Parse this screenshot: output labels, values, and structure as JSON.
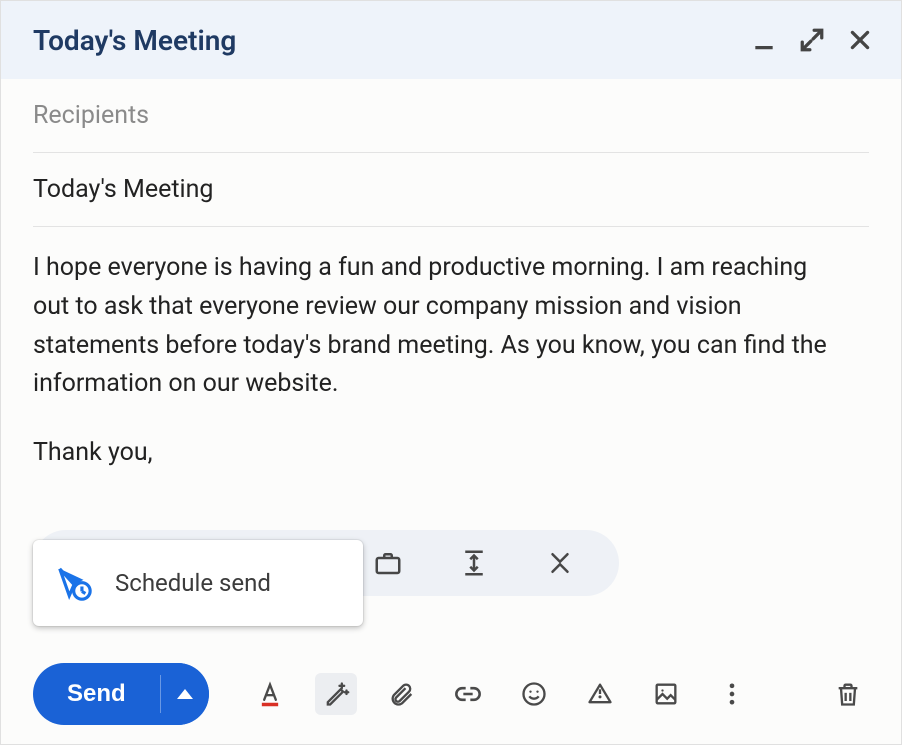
{
  "header": {
    "title": "Today's Meeting"
  },
  "compose": {
    "recipients_placeholder": "Recipients",
    "subject": "Today's Meeting",
    "body_paragraph_1": "I hope everyone is having a fun and productive morning. I am reaching out to ask that everyone review our company mission and vision statements before today's brand meeting. As you know, you can find the information on our website.",
    "body_paragraph_2": "Thank you,"
  },
  "schedule_menu": {
    "label": "Schedule send"
  },
  "toolbar": {
    "send_label": "Send"
  }
}
